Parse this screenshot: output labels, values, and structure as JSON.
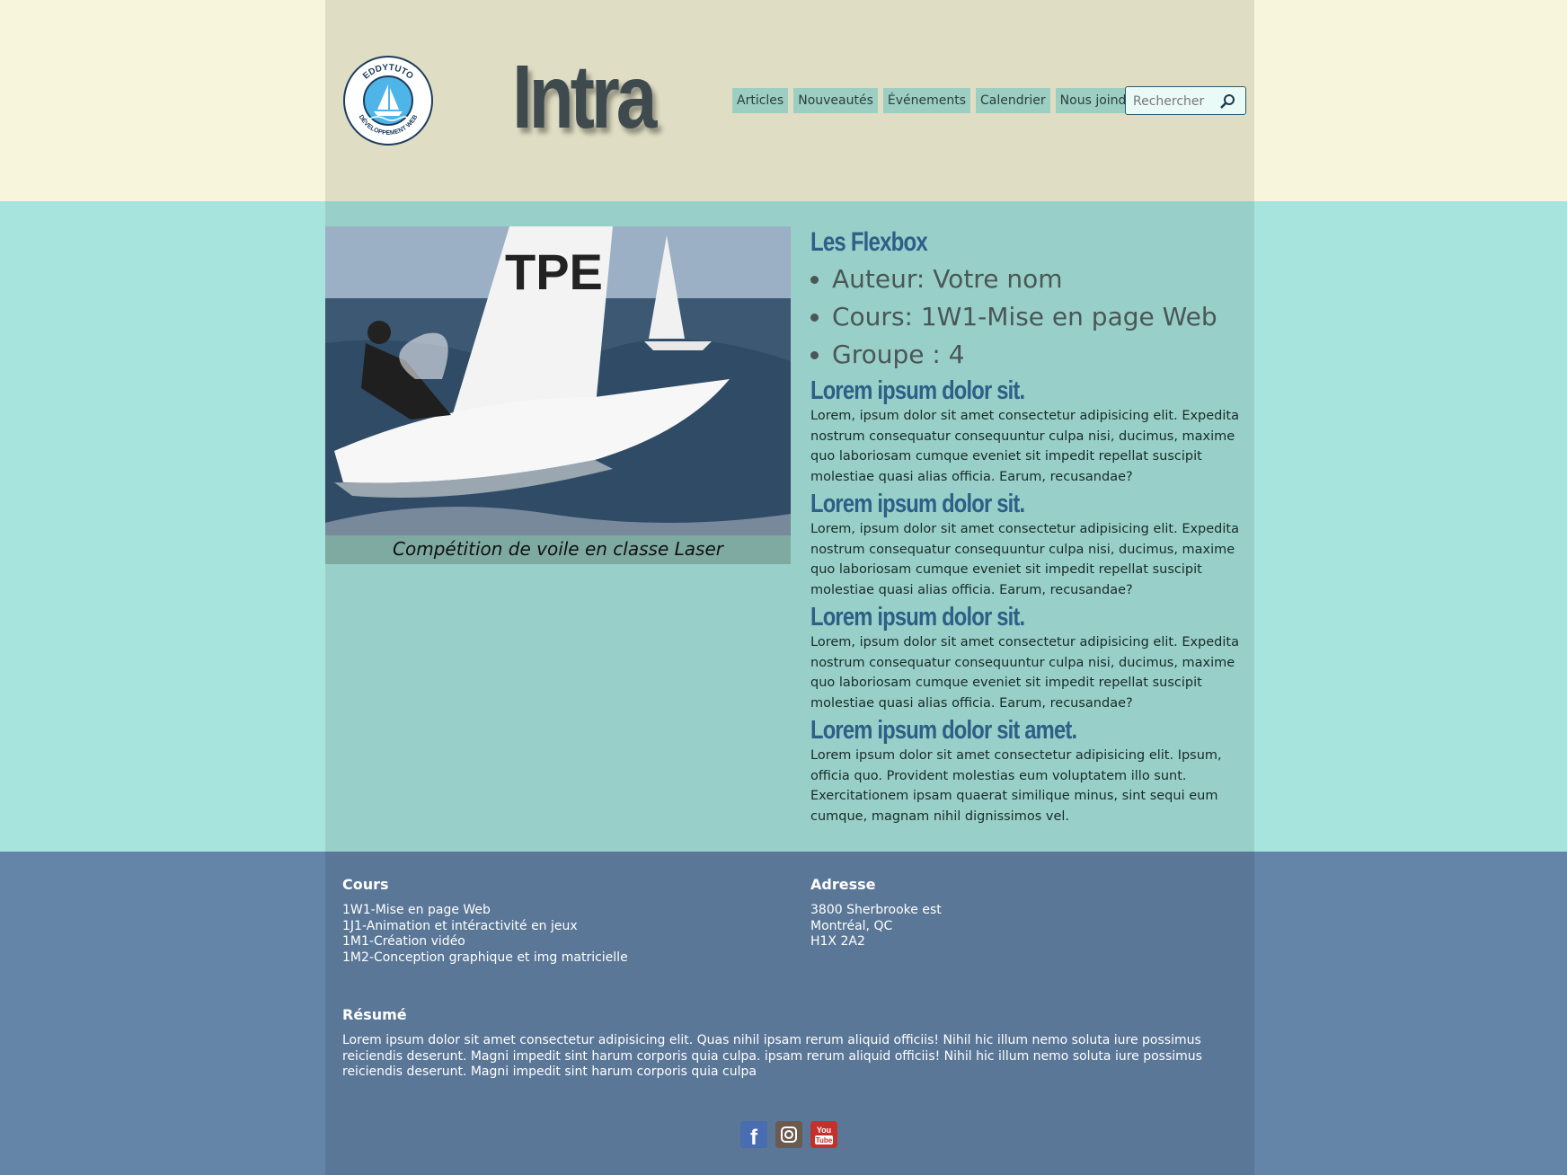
{
  "header": {
    "logo_text_top": "EDDYTUTO",
    "logo_text_bottom": "DÉVELOPPEMENT WEB",
    "site_title": "Intra",
    "nav": [
      "Articles",
      "Nouveautés",
      "Événements",
      "Calendrier",
      "Nous joindre"
    ],
    "search_placeholder": "Rechercher"
  },
  "figure": {
    "sail_text": "TPE",
    "caption": "Compétition de voile en classe Laser"
  },
  "article": {
    "title": "Les Flexbox",
    "meta": [
      "Auteur: Votre nom",
      "Cours: 1W1-Mise en page Web",
      "Groupe : 4"
    ],
    "sections": [
      {
        "title": "Lorem ipsum dolor sit.",
        "text": "Lorem, ipsum dolor sit amet consectetur adipisicing elit. Expedita nostrum consequatur consequuntur culpa nisi, ducimus, maxime quo laboriosam cumque eveniet sit impedit repellat suscipit molestiae quasi alias officia. Earum, recusandae?"
      },
      {
        "title": "Lorem ipsum dolor sit.",
        "text": "Lorem, ipsum dolor sit amet consectetur adipisicing elit. Expedita nostrum consequatur consequuntur culpa nisi, ducimus, maxime quo laboriosam cumque eveniet sit impedit repellat suscipit molestiae quasi alias officia. Earum, recusandae?"
      },
      {
        "title": "Lorem ipsum dolor sit.",
        "text": "Lorem, ipsum dolor sit amet consectetur adipisicing elit. Expedita nostrum consequatur consequuntur culpa nisi, ducimus, maxime quo laboriosam cumque eveniet sit impedit repellat suscipit molestiae quasi alias officia. Earum, recusandae?"
      },
      {
        "title": "Lorem ipsum dolor sit amet.",
        "text": "Lorem ipsum dolor sit amet consectetur adipisicing elit. Ipsum, officia quo. Provident molestias eum voluptatem illo sunt. Exercitationem ipsam quaerat similique minus, sint sequi eum cumque, magnam nihil dignissimos vel."
      }
    ]
  },
  "footer": {
    "courses_title": "Cours",
    "courses": [
      "1W1-Mise en page Web",
      "1J1-Animation et intéractivité en jeux",
      "1M1-Création vidéo",
      "1M2-Conception graphique et img matricielle"
    ],
    "address_title": "Adresse",
    "address": [
      "3800 Sherbrooke est",
      "Montréal, QC",
      "H1X 2A2"
    ],
    "summary_title": "Résumé",
    "summary": "Lorem ipsum dolor sit amet consectetur adipisicing elit. Quas nihil ipsam rerum aliquid officiis! Nihil hic illum nemo soluta iure possimus reiciendis deserunt. Magni impedit sint harum corporis quia culpa. ipsam rerum aliquid officiis! Nihil hic illum nemo soluta iure possimus reiciendis deserunt. Magni impedit sint harum corporis quia culpa",
    "socials": [
      {
        "name": "facebook-icon",
        "color": "#3b5998",
        "label": "f"
      },
      {
        "name": "instagram-icon",
        "color": "#6b5a4e",
        "label": ""
      },
      {
        "name": "youtube-icon",
        "color": "#c4302b",
        "label": "You Tube"
      }
    ]
  },
  "colors": {
    "header_outer": "#f7f6dc",
    "header_inner": "#dfddc3",
    "main_outer": "#a8e4de",
    "main_inner": "#98d0c9",
    "footer_outer": "#6484a8",
    "footer_inner": "#5a7797",
    "nav_bg": "#9ccfc2",
    "heading": "#2d5f87"
  }
}
